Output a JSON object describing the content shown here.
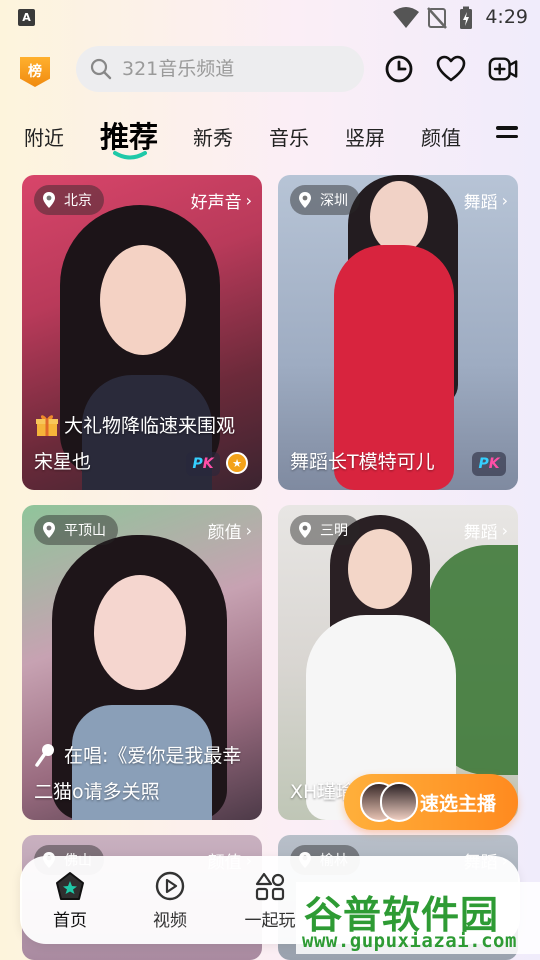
{
  "status_bar": {
    "badge": "A",
    "time": "4:29"
  },
  "header": {
    "rank_label": "榜",
    "search": {
      "placeholder": "321音乐频道"
    }
  },
  "tabs": [
    {
      "label": "附近"
    },
    {
      "label": "推荐",
      "active": true
    },
    {
      "label": "新秀"
    },
    {
      "label": "音乐"
    },
    {
      "label": "竖屏"
    },
    {
      "label": "颜值"
    }
  ],
  "cards": [
    {
      "location": "北京",
      "category": "好声音",
      "banner": "大礼物降临速来围观",
      "name": "宋星也",
      "pk": true,
      "gold": true
    },
    {
      "location": "深圳",
      "category": "舞蹈",
      "name": "舞蹈长T模特可儿",
      "pk": true
    },
    {
      "location": "平顶山",
      "category": "颜值",
      "banner": "在唱:《爱你是我最幸",
      "name": "二猫o请多关照"
    },
    {
      "location": "三明",
      "category": "舞蹈",
      "name": "XH瑾瑜"
    },
    {
      "location": "佛山",
      "category": "颜值"
    },
    {
      "location": "榆林",
      "category": "舞蹈"
    }
  ],
  "quick_pick": {
    "label": "速选主播"
  },
  "pk_label": {
    "p": "P",
    "k": "K"
  },
  "bottom_nav": [
    {
      "label": "首页",
      "active": true
    },
    {
      "label": "视频"
    },
    {
      "label": "一起玩"
    }
  ],
  "watermark": {
    "title": "谷普软件园",
    "url": "www.gupuxiazai.com"
  },
  "colors": {
    "accent_teal": "#1fc9a8",
    "orange": "#ff9a2a",
    "watermark_green": "#2e9b34"
  }
}
